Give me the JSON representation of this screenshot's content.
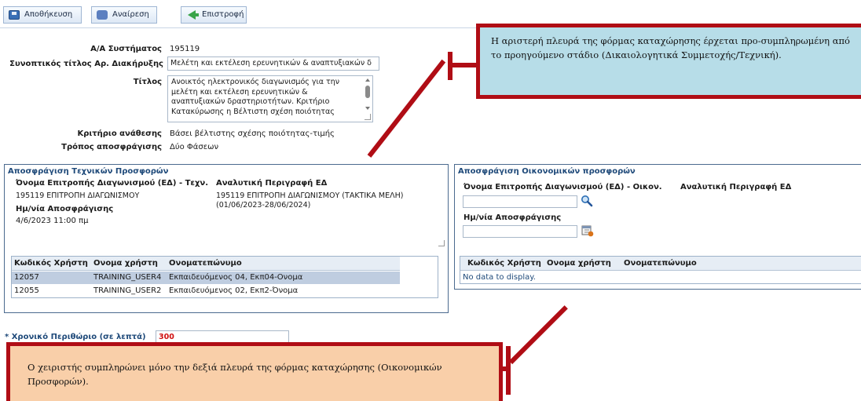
{
  "toolbar": {
    "save_label": "Αποθήκευση",
    "undo_label": "Αναίρεση",
    "back_label": "Επιστροφή"
  },
  "form": {
    "aa_label": "Α/Α Συστήματος",
    "aa_value": "195119",
    "summary_title_label": "Συνοπτικός τίτλος Αρ. Διακήρυξης",
    "summary_title_value": "Μελέτη και εκτέλεση ερευνητικών & αναπτυξιακών δ",
    "title_label": "Τίτλος",
    "title_value": "Ανοικτός ηλεκτρονικός διαγωνισμός για την μελέτη και εκτέλεση ερευνητικών & αναπτυξιακών δραστηριοτήτων. Κριτήριο Κατακύρωσης η Βέλτιστη σχέση ποιότητας",
    "criterion_label": "Κριτήριο ανάθεσης",
    "criterion_value": "Βάσει βέλτιστης σχέσης ποιότητας-τιμής",
    "method_label": "Τρόπος αποσφράγισης",
    "method_value": "Δύο Φάσεων"
  },
  "technical": {
    "title": "Αποσφράγιση Τεχνικών Προσφορών",
    "committee_label": "Όνομα Επιτροπής Διαγωνισμού (ΕΔ) - Τεχν.",
    "description_label": "Αναλυτική Περιγραφή ΕΔ",
    "committee_value": "195119 ΕΠΙΤΡΟΠΗ ΔΙΑΓΩΝΙΣΜΟΥ",
    "description_value": "195119 ΕΠΙΤΡΟΠΗ ΔΙΑΓΩΝΙΣΜΟΥ (ΤΑΚΤΙΚΑ ΜΕΛΗ) (01/06/2023-28/06/2024)",
    "date_label": "Ημ/νία Αποσφράγισης",
    "date_value": "4/6/2023 11:00 πμ",
    "columns": [
      "Κωδικός Χρήστη",
      "Ονομα χρήστη",
      "Ονοματεπώνυμο"
    ],
    "rows": [
      [
        "12057",
        "TRAINING_USER4",
        "Εκπαιδευόμενος 04, Εκπ04-Ονομα"
      ],
      [
        "12055",
        "TRAINING_USER2",
        "Εκπαιδευόμενος 02, Εκπ2-Όνομα"
      ]
    ]
  },
  "financial": {
    "title": "Αποσφράγιση Οικονομικών προσφορών",
    "committee_label": "Όνομα Επιτροπής Διαγωνισμού (ΕΔ) - Οικον.",
    "description_label": "Αναλυτική Περιγραφή ΕΔ",
    "date_label": "Ημ/νία Αποσφράγισης",
    "columns": [
      "Κωδικός Χρήστη",
      "Ονομα χρήστη",
      "Ονοματεπώνυμο"
    ],
    "empty_text": "No data to display."
  },
  "time_margin": {
    "label": "* Χρονικό Περιθώριο (σε λεπτά)",
    "value": "300"
  },
  "callouts": {
    "top_text": "Η αριστερή πλευρά της φόρμας καταχώρησης έρχεται προ-συμπληρωμένη από το προηγούμενο στάδιο (Δικαιολογητικά Συμμετοχής/Τεχνική).",
    "bottom_text": "Ο χειριστής συμπληρώνει μόνο την δεξιά πλευρά της φόρμας καταχώρησης (Οικονομικών Προσφορών)."
  },
  "colors": {
    "callout_top_bg": "#b7dde8",
    "callout_bottom_bg": "#f9cfa9",
    "callout_border": "#b00d15",
    "selected_row": "#bfcde0",
    "panel_title": "#1f4a7a"
  },
  "icons": [
    "save-icon",
    "undo-icon",
    "back-arrow-icon",
    "search-icon",
    "calendar-icon"
  ]
}
